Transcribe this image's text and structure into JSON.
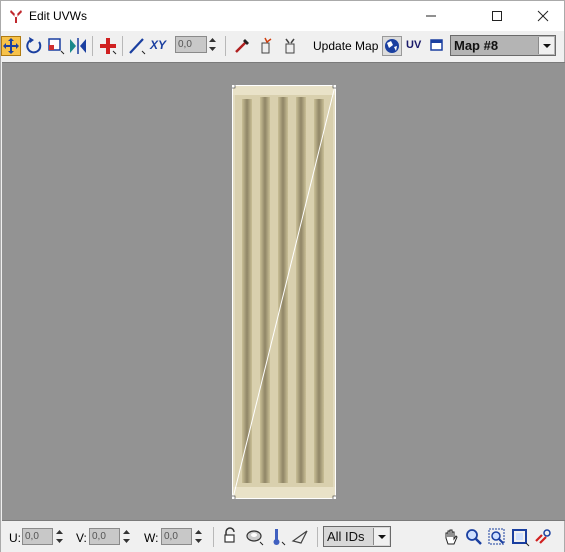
{
  "window": {
    "title": "Edit UVWs",
    "controls": [
      "minimize",
      "maximize",
      "close"
    ]
  },
  "toolbar": {
    "tools": [
      "move-icon",
      "rotate-icon",
      "scale-icon",
      "mirror-icon",
      "freeform-icon",
      "snap-icon",
      "xy-icon",
      "eyedropper-icon",
      "break-icon",
      "weld-icon"
    ],
    "xy_label": "XY",
    "offset_value": "0,0",
    "update_map_label": "Update Map",
    "uv_label": "UV",
    "map_selected": "Map #8"
  },
  "bottom": {
    "u_label": "U:",
    "u_value": "0,0",
    "v_label": "V:",
    "v_value": "0,0",
    "w_label": "W:",
    "w_value": "0,0",
    "ids_selected": "All IDs",
    "nav_tools": [
      "lock-icon",
      "hide-icon",
      "freeze-icon",
      "filter-icon",
      "pan-icon",
      "zoom-icon",
      "zoom-region-icon",
      "zoom-extents-icon",
      "snap-toggle-icon"
    ]
  },
  "colors": {
    "viewport_bg": "#939393",
    "texture": "#e3dcc0",
    "active_tool": "#f7c24a",
    "map_select_bg": "#b4b4b4"
  }
}
